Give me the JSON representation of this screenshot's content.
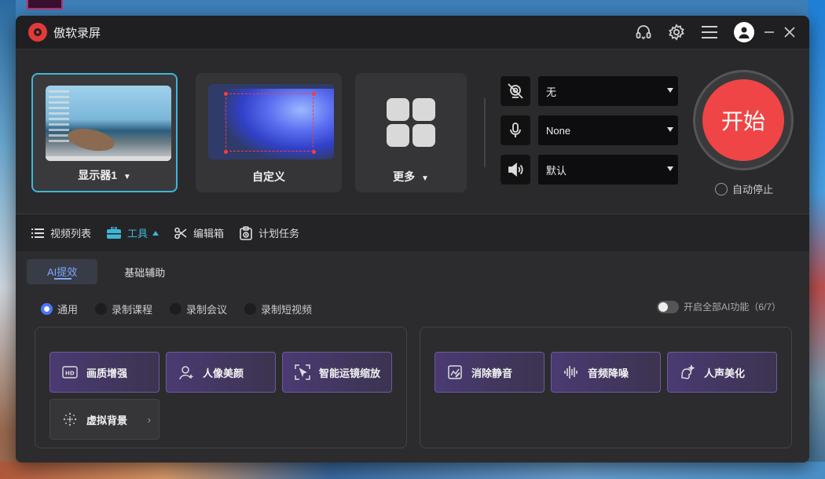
{
  "app": {
    "title": "傲软录屏"
  },
  "sources": [
    {
      "label": "显示器1",
      "has_dropdown": true,
      "active": true
    },
    {
      "label": "自定义",
      "has_dropdown": false,
      "active": false
    },
    {
      "label": "更多",
      "has_dropdown": true,
      "active": false
    }
  ],
  "devices": {
    "camera": {
      "value": "无",
      "icon": "camera-off-icon"
    },
    "microphone": {
      "value": "None",
      "icon": "microphone-icon"
    },
    "speaker": {
      "value": "默认",
      "icon": "speaker-icon"
    }
  },
  "start": {
    "label": "开始",
    "autostop_label": "自动停止"
  },
  "tabs": [
    {
      "label": "视频列表",
      "icon": "list-icon",
      "active": false
    },
    {
      "label": "工具",
      "icon": "toolbox-icon",
      "active": true
    },
    {
      "label": "编辑箱",
      "icon": "scissors-icon",
      "active": false
    },
    {
      "label": "计划任务",
      "icon": "clipboard-icon",
      "active": false
    }
  ],
  "subtabs": [
    {
      "label": "AI提效",
      "active": true
    },
    {
      "label": "基础辅助",
      "active": false
    }
  ],
  "modes": [
    {
      "label": "通用",
      "selected": true
    },
    {
      "label": "录制课程",
      "selected": false
    },
    {
      "label": "录制会议",
      "selected": false
    },
    {
      "label": "录制短视频",
      "selected": false
    }
  ],
  "ai_toggle": {
    "label": "开启全部AI功能（6/7）",
    "on": false
  },
  "video_features": [
    {
      "label": "画质增强",
      "icon": "hd-icon"
    },
    {
      "label": "人像美颜",
      "icon": "portrait-icon"
    },
    {
      "label": "智能运镜缩放",
      "icon": "smart-zoom-icon"
    },
    {
      "label": "虚拟背景",
      "icon": "virtual-background-icon",
      "arrow": "›"
    }
  ],
  "audio_features": [
    {
      "label": "消除静音",
      "icon": "remove-silence-icon"
    },
    {
      "label": "音频降噪",
      "icon": "noise-reduction-icon"
    },
    {
      "label": "人声美化",
      "icon": "voice-beautify-icon"
    }
  ],
  "colors": {
    "accent": "#3fb6d8",
    "start": "#f04546",
    "feature": "#4a3a72",
    "link": "#7fa6ff"
  }
}
